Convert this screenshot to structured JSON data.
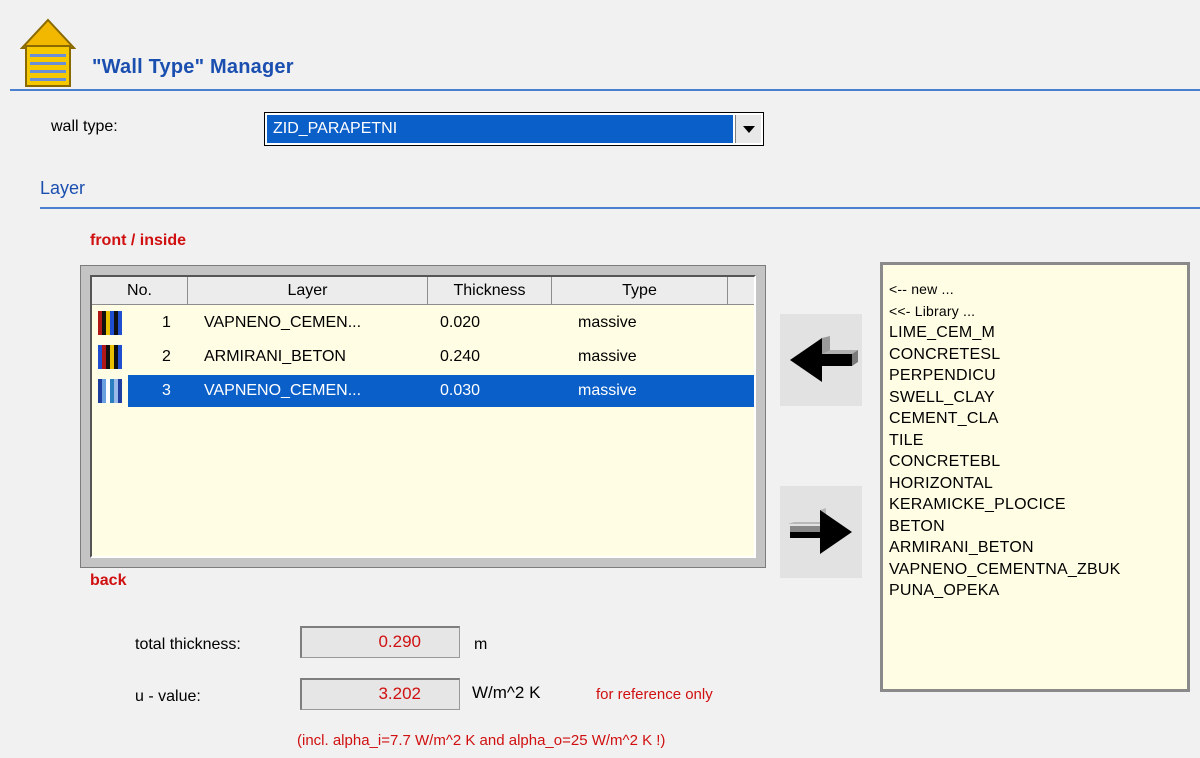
{
  "header": {
    "title": "\"Wall Type\" Manager",
    "icon": "house-icon"
  },
  "wall_type": {
    "label": "wall type:",
    "selected": "ZID_PARAPETNI"
  },
  "section_title": "Layer",
  "front_label": "front / inside",
  "back_label": "back",
  "table": {
    "columns": [
      "No.",
      "Layer",
      "Thickness",
      "Type"
    ],
    "rows": [
      {
        "no": "1",
        "layer": "VAPNENO_CEMEN...",
        "thickness": "0.020",
        "type": "massive",
        "selected": false
      },
      {
        "no": "2",
        "layer": "ARMIRANI_BETON",
        "thickness": "0.240",
        "type": "massive",
        "selected": false
      },
      {
        "no": "3",
        "layer": "VAPNENO_CEMEN...",
        "thickness": "0.030",
        "type": "massive",
        "selected": true
      }
    ]
  },
  "library": {
    "items": [
      "<-- new ...",
      "<<- Library ...",
      "LIME_CEM_M",
      "CONCRETESL",
      "PERPENDICU",
      "SWELL_CLAY",
      "CEMENT_CLA",
      "TILE",
      "CONCRETEBL",
      "HORIZONTAL",
      "KERAMICKE_PLOCICE",
      "BETON",
      "ARMIRANI_BETON",
      "VAPNENO_CEMENTNA_ZBUK",
      "PUNA_OPEKA"
    ]
  },
  "totals": {
    "thickness_label": "total thickness:",
    "thickness_value": "0.290",
    "thickness_unit": "m",
    "u_label": "u - value:",
    "u_value": "3.202",
    "u_unit": "W/m^2 K",
    "reference_note": "for reference only",
    "incl_note": "(incl. alpha_i=7.7 W/m^2 K and alpha_o=25 W/m^2 K !)"
  },
  "colors": {
    "accent": "#1a4fb0",
    "selection": "#0b5fc9",
    "warning": "#d01010",
    "list_bg": "#fffde3"
  }
}
